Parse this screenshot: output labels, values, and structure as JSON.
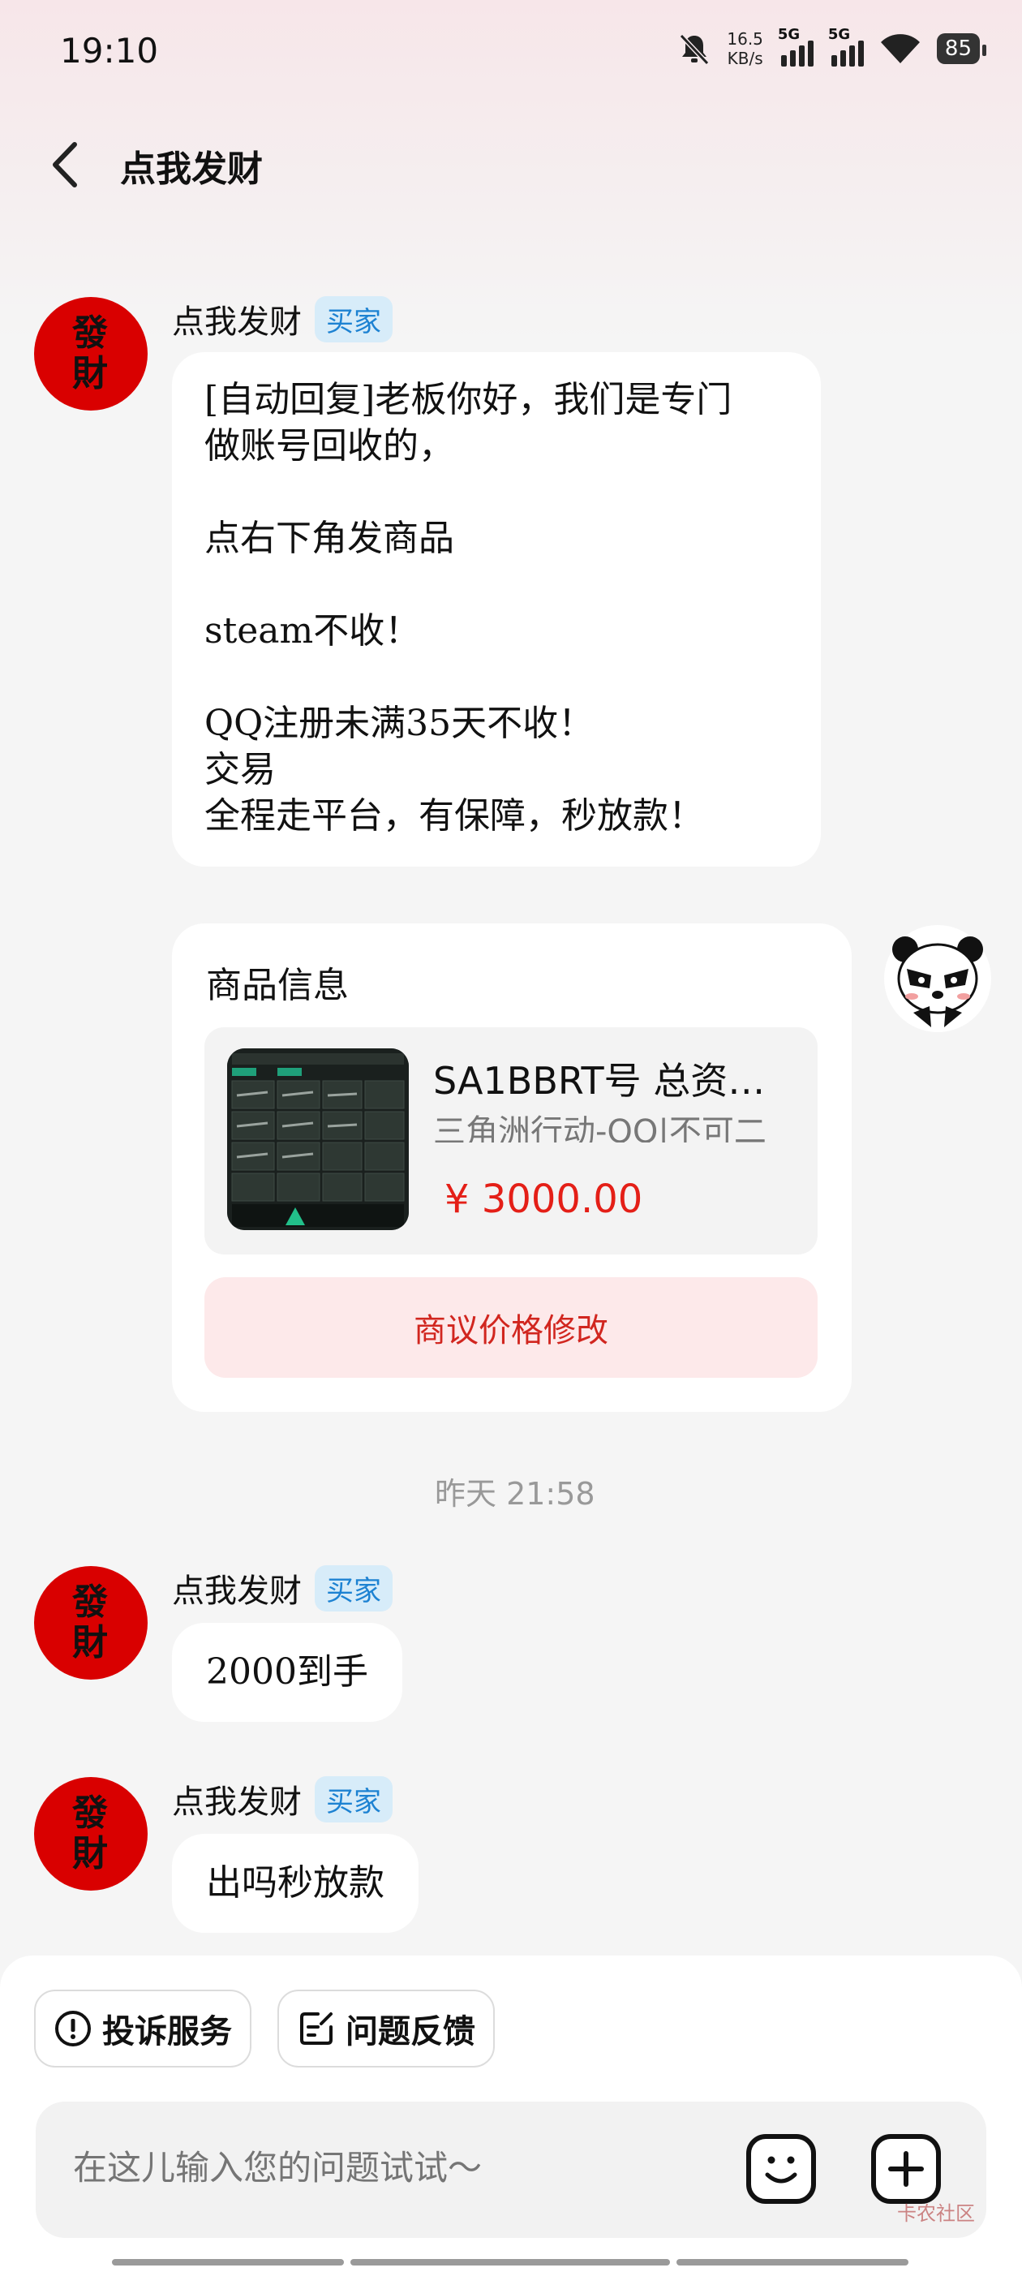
{
  "status": {
    "time": "19:10",
    "speed_value": "16.5",
    "speed_unit": "KB/s",
    "sim1": "5G",
    "sim2": "5G",
    "battery": "85"
  },
  "header": {
    "title": "点我发财"
  },
  "seller": {
    "avatar_line1": "發",
    "avatar_line2": "財",
    "name": "点我发财",
    "role_badge": "买家"
  },
  "messages": [
    {
      "text": "[自动回复]老板你好，我们是专门\n做账号回收的，\n\n点右下角发商品\n\nsteam不收！\n\nQQ注册未满35天不收！\n交易\n全程走平台，有保障，秒放款！"
    },
    {
      "text": "2000到手"
    },
    {
      "text": "出吗秒放款"
    }
  ],
  "product_card": {
    "heading": "商品信息",
    "name": "SA1BBRT号 总资…",
    "subtitle": "三角洲行动-QQ|不可二",
    "price": "¥ 3000.00",
    "negotiate_label": "商议价格修改"
  },
  "timestamp": "昨天 21:58",
  "actions": {
    "complaint": "投诉服务",
    "feedback": "问题反馈"
  },
  "input": {
    "placeholder": "在这儿输入您的问题试试～"
  },
  "watermark": "卡农社区",
  "colors": {
    "avatar_red": "#d90000",
    "badge_blue": "#1d82d2",
    "price_red": "#e41f17"
  }
}
